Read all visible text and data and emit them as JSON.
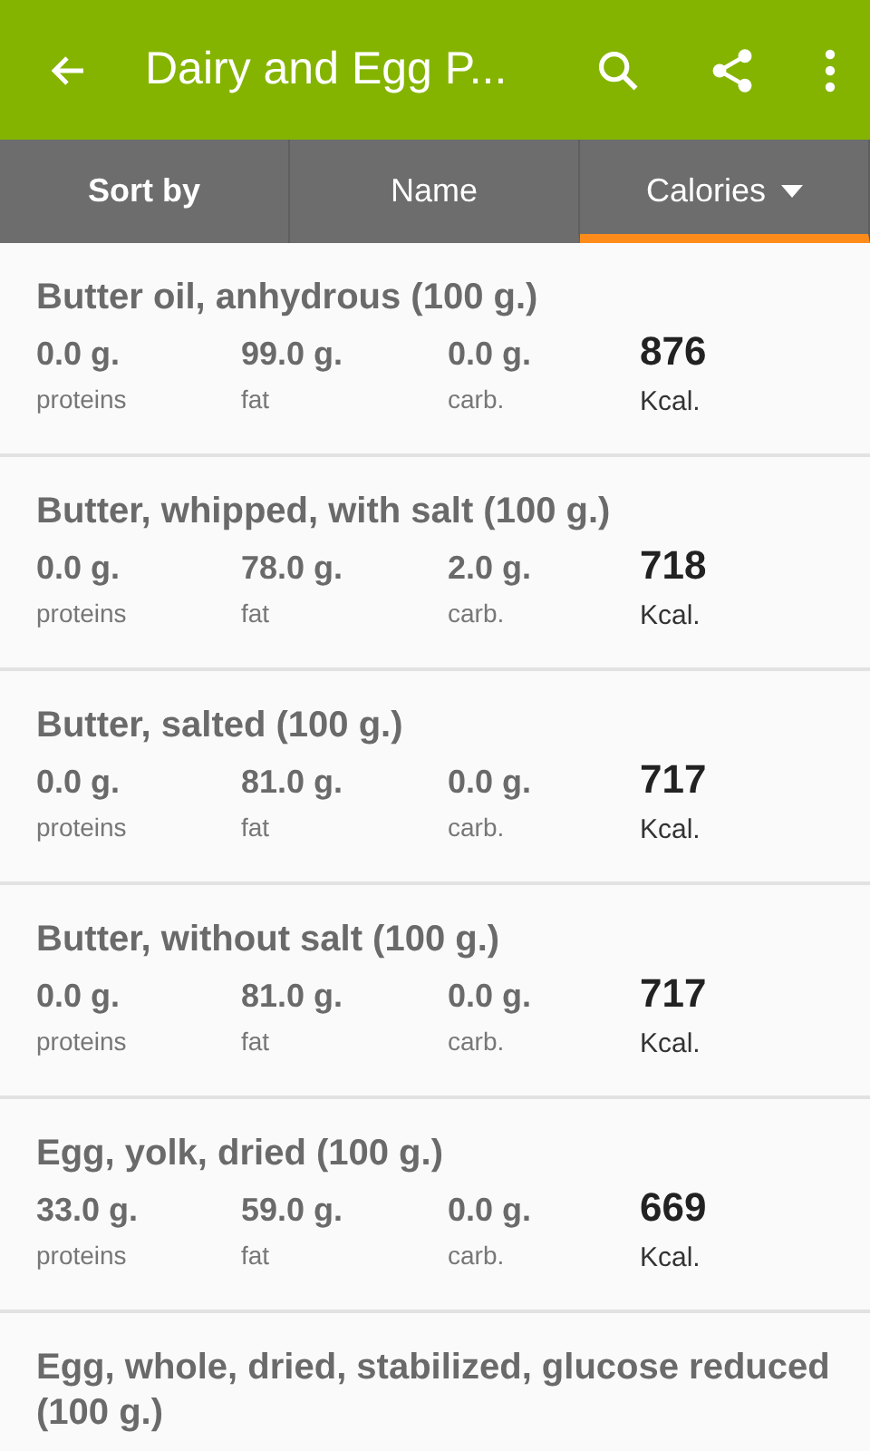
{
  "app_bar": {
    "title": "Dairy and Egg P..."
  },
  "sort_bar": {
    "label": "Sort by",
    "tabs": [
      {
        "label": "Name",
        "selected": false,
        "dropdown": false
      },
      {
        "label": "Calories",
        "selected": true,
        "dropdown": true
      }
    ]
  },
  "foods": [
    {
      "name": "Butter oil, anhydrous (100 g.)",
      "proteins": "0.0 g.",
      "proteins_label": "proteins",
      "fat": "99.0 g.",
      "fat_label": "fat",
      "carbs": "0.0 g.",
      "carbs_label": "carb.",
      "kcal": "876",
      "kcal_label": "Kcal."
    },
    {
      "name": "Butter, whipped, with salt (100 g.)",
      "proteins": "0.0 g.",
      "proteins_label": "proteins",
      "fat": "78.0 g.",
      "fat_label": "fat",
      "carbs": "2.0 g.",
      "carbs_label": "carb.",
      "kcal": "718",
      "kcal_label": "Kcal."
    },
    {
      "name": "Butter, salted (100 g.)",
      "proteins": "0.0 g.",
      "proteins_label": "proteins",
      "fat": "81.0 g.",
      "fat_label": "fat",
      "carbs": "0.0 g.",
      "carbs_label": "carb.",
      "kcal": "717",
      "kcal_label": "Kcal."
    },
    {
      "name": "Butter, without salt (100 g.)",
      "proteins": "0.0 g.",
      "proteins_label": "proteins",
      "fat": "81.0 g.",
      "fat_label": "fat",
      "carbs": "0.0 g.",
      "carbs_label": "carb.",
      "kcal": "717",
      "kcal_label": "Kcal."
    },
    {
      "name": "Egg, yolk, dried (100 g.)",
      "proteins": "33.0 g.",
      "proteins_label": "proteins",
      "fat": "59.0 g.",
      "fat_label": "fat",
      "carbs": "0.0 g.",
      "carbs_label": "carb.",
      "kcal": "669",
      "kcal_label": "Kcal."
    },
    {
      "name": "Egg, whole, dried, stabilized, glucose reduced (100 g.)"
    }
  ]
}
